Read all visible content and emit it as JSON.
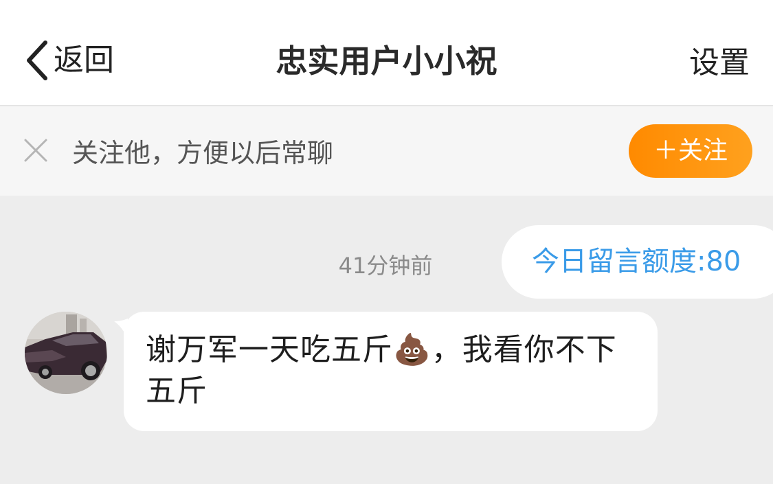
{
  "navbar": {
    "back_label": "返回",
    "title": "忠实用户小小祝",
    "settings_label": "设置"
  },
  "follow_bar": {
    "prompt": "关注他，方便以后常聊",
    "follow_button": "＋关注"
  },
  "chat": {
    "timestamp": "41分钟前",
    "quota_label": "今日留言额度:80",
    "messages": [
      {
        "text": "谢万军一天吃五斤💩，我看你不下五斤"
      }
    ]
  },
  "colors": {
    "accent_orange": "#ff8a00",
    "quota_blue": "#3a9be8",
    "background": "#ededed"
  },
  "icons": [
    "chevron-left-icon",
    "close-icon",
    "avatar-car-photo"
  ]
}
